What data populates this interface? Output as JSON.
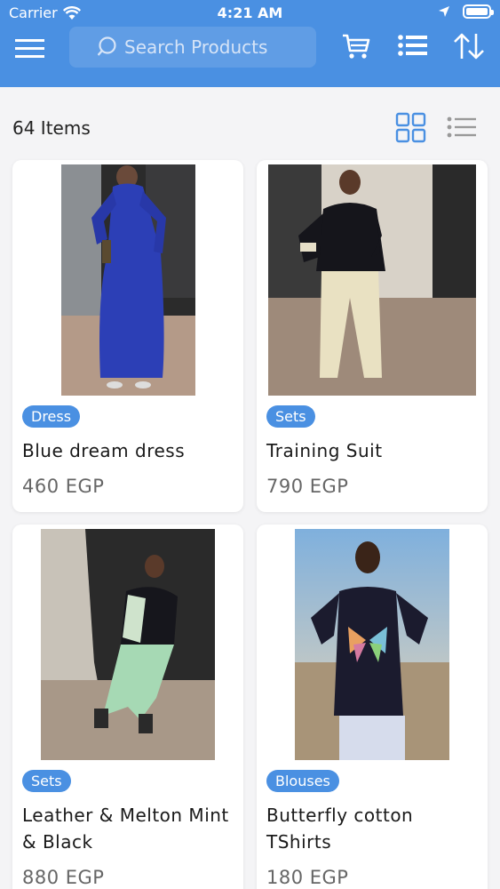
{
  "status_bar": {
    "carrier": "Carrier",
    "time": "4:21 AM"
  },
  "toolbar": {
    "search_placeholder": "Search Products",
    "icons": [
      "menu-icon",
      "search-icon",
      "cart-icon",
      "list-icon",
      "sort-icon"
    ]
  },
  "listing": {
    "items_count": "64 Items"
  },
  "colors": {
    "primary": "#4a90e2",
    "background": "#f4f4f6"
  },
  "products": [
    {
      "category": "Dress",
      "name": "Blue dream dress",
      "price": "460 EGP"
    },
    {
      "category": "Sets",
      "name": "Training Suit",
      "price": "790 EGP"
    },
    {
      "category": "Sets",
      "name": "Leather & Melton Mint & Black",
      "price": "880 EGP"
    },
    {
      "category": "Blouses",
      "name": "Butterfly cotton TShirts",
      "price": "180 EGP"
    }
  ]
}
